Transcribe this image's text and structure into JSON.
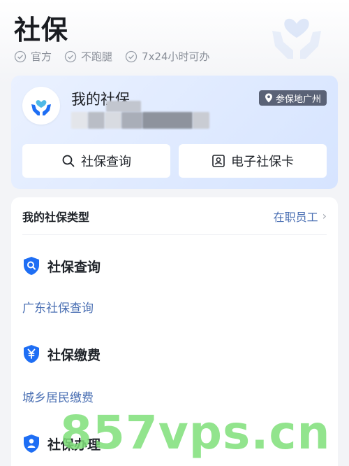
{
  "header": {
    "title": "社保",
    "badges": [
      "官方",
      "不跑腿",
      "7x24小时可办"
    ]
  },
  "card": {
    "title": "我的社保",
    "location": "参保地广州",
    "buttons": {
      "query": "社保查询",
      "ecard": "电子社保卡"
    }
  },
  "insurance_type": {
    "label": "我的社保类型",
    "value": "在职员工"
  },
  "groups": [
    {
      "title": "社保查询",
      "link": "广东社保查询",
      "icon": "search-shield-icon"
    },
    {
      "title": "社保缴费",
      "link": "城乡居民缴费",
      "icon": "yuan-shield-icon"
    },
    {
      "title": "社保办理",
      "link": "",
      "icon": "person-shield-icon"
    }
  ],
  "watermark": "857vps.cn",
  "colors": {
    "accent": "#1e6ef4",
    "link": "#4a6fb3",
    "card_bg": "#d6e4ff"
  }
}
